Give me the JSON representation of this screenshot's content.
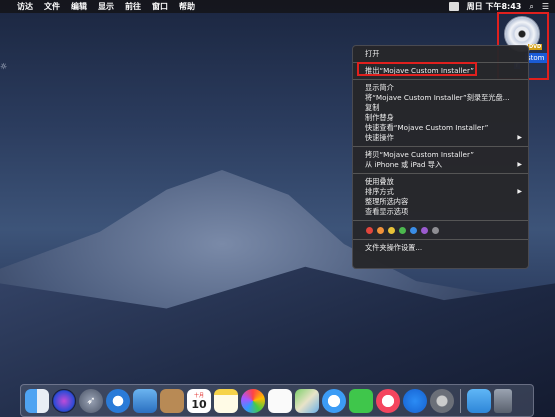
{
  "menubar": {
    "apple_glyph": "",
    "items": [
      "访达",
      "文件",
      "编辑",
      "显示",
      "前往",
      "窗口",
      "帮助"
    ],
    "clock": "周日 下午8:43",
    "search_glyph": "⌕",
    "list_glyph": "☰"
  },
  "desktop": {
    "disk_badge": "DVD",
    "disk_label": "stom",
    "disk_label2": "r",
    "edge_glyph": "☼"
  },
  "context_menu": {
    "open": "打开",
    "eject": "推出“Mojave Custom Installer”",
    "get_info": "显示简介",
    "burn": "将“Mojave Custom Installer”刻录至光盘...",
    "duplicate": "复制",
    "make_alias": "制作替身",
    "quick_look": "快速查看“Mojave Custom Installer”",
    "quick_actions": "快速操作",
    "copy": "拷贝“Mojave Custom Installer”",
    "import_iphone": "从 iPhone 或 iPad 导入",
    "use_stacks": "使用叠放",
    "sort_by": "排序方式",
    "clean_up": "整理所选内容",
    "view_options": "查看显示选项",
    "folder_actions": "文件夹操作设置...",
    "submenu_arrow": "▶",
    "tag_colors": [
      "#e2453c",
      "#f0923a",
      "#e8c238",
      "#4cb84e",
      "#3a8de6",
      "#9a5bcf",
      "#8e8e93"
    ]
  },
  "dock": {
    "calendar_month": "十月",
    "calendar_day": "10",
    "icons": [
      "finder-icon",
      "siri-icon",
      "launchpad-icon",
      "safari-icon",
      "preview-icon",
      "contacts-icon",
      "calendar-icon",
      "notes-icon",
      "photos-icon",
      "reminders-icon",
      "maps-icon",
      "messages-icon",
      "facetime-icon",
      "music-icon",
      "app-store-icon",
      "system-preferences-icon",
      "downloads-folder-icon",
      "trash-icon"
    ]
  }
}
